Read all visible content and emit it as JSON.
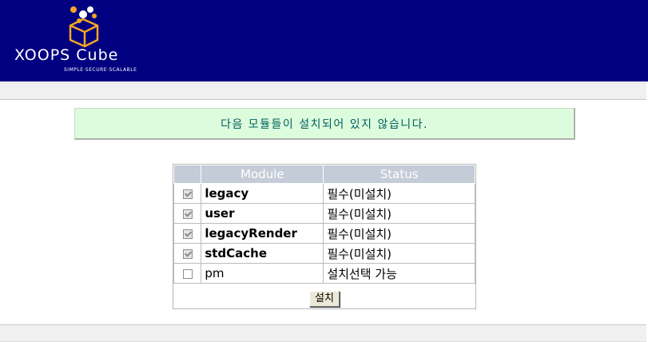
{
  "logo": {
    "name": "XOOPS Cube",
    "tagline": "SIMPLE·SECURE·SCALABLE",
    "colors": {
      "cube": "#f5a623",
      "dots": "#ffffff"
    }
  },
  "header": {
    "bg_color": "#000080"
  },
  "notice": {
    "text": "다음 모듈들이 설치되어 있지 않습니다."
  },
  "table": {
    "headers": {
      "module": "Module",
      "status": "Status"
    },
    "rows": [
      {
        "module": "legacy",
        "status": "필수(미설치)",
        "checked": true,
        "required": true
      },
      {
        "module": "user",
        "status": "필수(미설치)",
        "checked": true,
        "required": true
      },
      {
        "module": "legacyRender",
        "status": "필수(미설치)",
        "checked": true,
        "required": true
      },
      {
        "module": "stdCache",
        "status": "필수(미설치)",
        "checked": true,
        "required": true
      },
      {
        "module": "pm",
        "status": "설치선택 가능",
        "checked": false,
        "required": false
      }
    ],
    "install_button": "설치"
  }
}
